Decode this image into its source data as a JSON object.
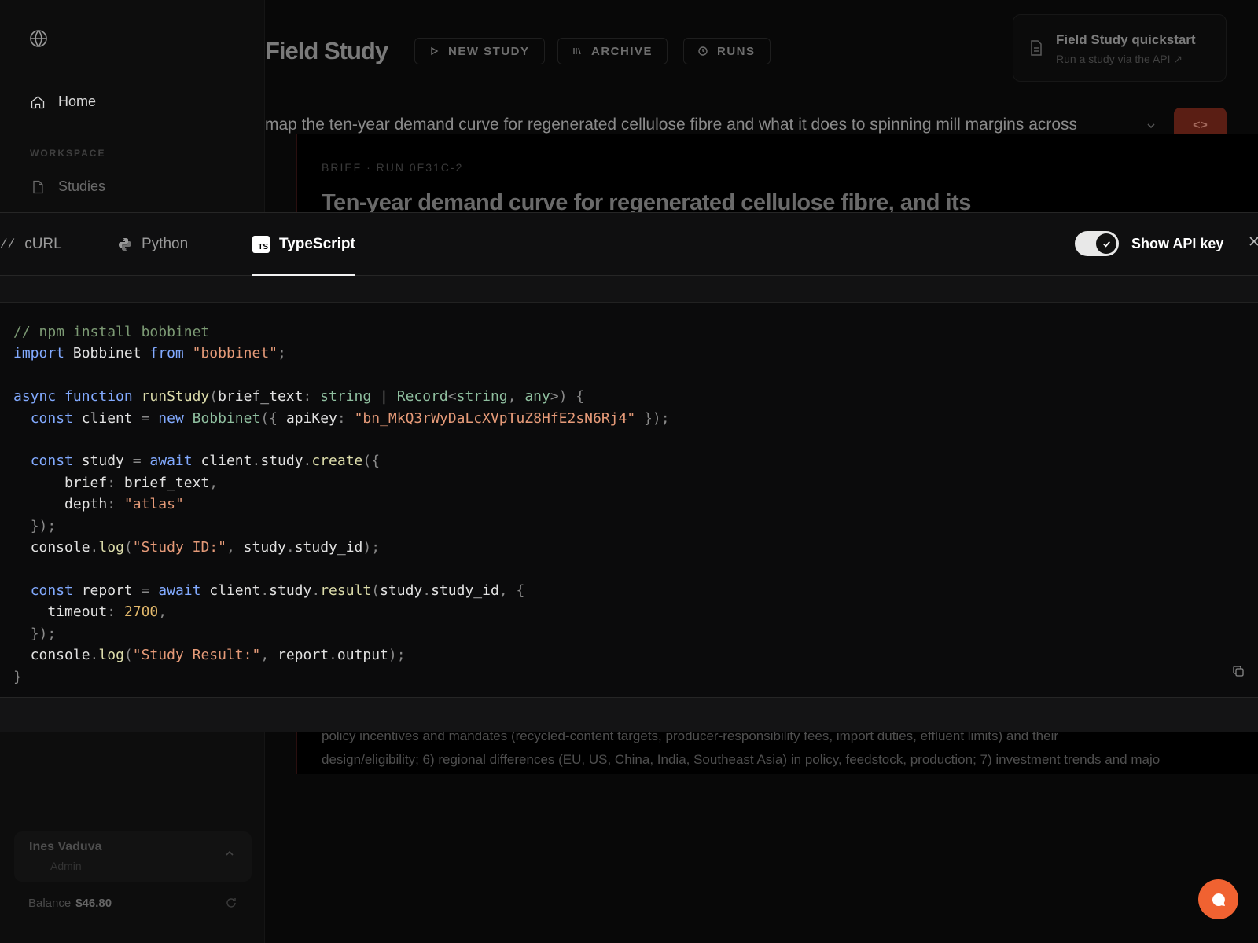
{
  "app": {
    "sidebar": {
      "nav_home": "Home",
      "workspace_label": "WORKSPACE",
      "nav_studies": "Studies",
      "user_name": "Ines Vaduva",
      "user_role": "Admin",
      "balance_label": "Balance",
      "balance_value": "$46.80"
    },
    "header": {
      "title": "Field Study",
      "btn_new_study": "NEW STUDY",
      "btn_archive": "ARCHIVE",
      "btn_runs": "RUNS",
      "quickstart_title": "Field Study quickstart",
      "quickstart_sub": "Run a study via the API ↗"
    },
    "query_text": "map the ten-year demand curve for regenerated cellulose fibre and what it does to spinning mill margins across",
    "brief": {
      "tag": "BRIEF · RUN 0F31C-2",
      "heading": "Ten-year demand curve for regenerated cellulose fibre, and its",
      "body_line1": "policy incentives and mandates (recycled-content targets, producer-responsibility fees, import duties, effluent limits) and their",
      "body_line2": "design/eligibility; 6) regional differences (EU, US, China, India, Southeast Asia) in policy, feedstock, production; 7) investment trends and majo"
    }
  },
  "drawer": {
    "tabs": [
      {
        "label": "cURL",
        "icon": "terminal-icon"
      },
      {
        "label": "Python",
        "icon": "python-icon"
      },
      {
        "label": "TypeScript",
        "icon": "typescript-icon",
        "badge": "TS",
        "active": true
      }
    ],
    "toggle_label": "Show API key",
    "toggle_on": true,
    "code": {
      "language": "typescript",
      "api_key": "bn_MkQ3rWyDaLcXVpTuZ8HfE2sN6Rj4",
      "package": "bobbinet",
      "class_name": "Bobbinet",
      "function_name": "runStudy",
      "depth": "atlas",
      "timeout": "2700",
      "log_id": "Study ID:",
      "log_result": "Study Result:"
    }
  },
  "colors": {
    "accent": "#f06231",
    "code_button_bg": "#5a1e14",
    "keyword": "#82aaff",
    "string": "#e59a78",
    "number": "#e2b86b",
    "comment": "#7c9a74"
  }
}
